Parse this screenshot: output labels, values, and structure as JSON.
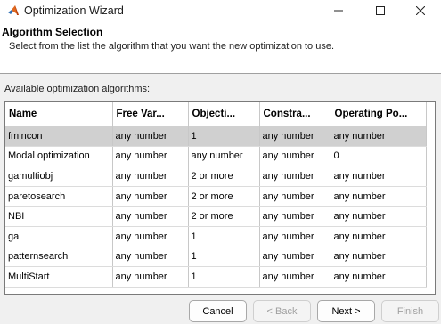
{
  "window": {
    "title": "Optimization Wizard"
  },
  "header": {
    "title": "Algorithm Selection",
    "description": "Select from the list the algorithm that you want the new optimization to use."
  },
  "list": {
    "label": "Available optimization algorithms:",
    "columns": [
      "Name",
      "Free Var...",
      "Objecti...",
      "Constra...",
      "Operating Po..."
    ],
    "rows": [
      {
        "cells": [
          "fmincon",
          "any number",
          "1",
          "any number",
          "any number"
        ],
        "selected": true
      },
      {
        "cells": [
          "Modal optimization",
          "any number",
          "any number",
          "any number",
          "0"
        ],
        "selected": false
      },
      {
        "cells": [
          "gamultiobj",
          "any number",
          "2 or more",
          "any number",
          "any number"
        ],
        "selected": false
      },
      {
        "cells": [
          "paretosearch",
          "any number",
          "2 or more",
          "any number",
          "any number"
        ],
        "selected": false
      },
      {
        "cells": [
          "NBI",
          "any number",
          "2 or more",
          "any number",
          "any number"
        ],
        "selected": false
      },
      {
        "cells": [
          "ga",
          "any number",
          "1",
          "any number",
          "any number"
        ],
        "selected": false
      },
      {
        "cells": [
          "patternsearch",
          "any number",
          "1",
          "any number",
          "any number"
        ],
        "selected": false
      },
      {
        "cells": [
          "MultiStart",
          "any number",
          "1",
          "any number",
          "any number"
        ],
        "selected": false
      }
    ]
  },
  "buttons": {
    "cancel": "Cancel",
    "back": "< Back",
    "next": "Next >",
    "finish": "Finish"
  },
  "icons": {
    "app": "matlab-icon",
    "minimize": "minimize-icon",
    "maximize": "maximize-icon",
    "close": "close-icon"
  },
  "colors": {
    "selected_row": "#d0d0d0",
    "header_background": "#ffffff",
    "dialog_background": "#f0f0f0"
  }
}
